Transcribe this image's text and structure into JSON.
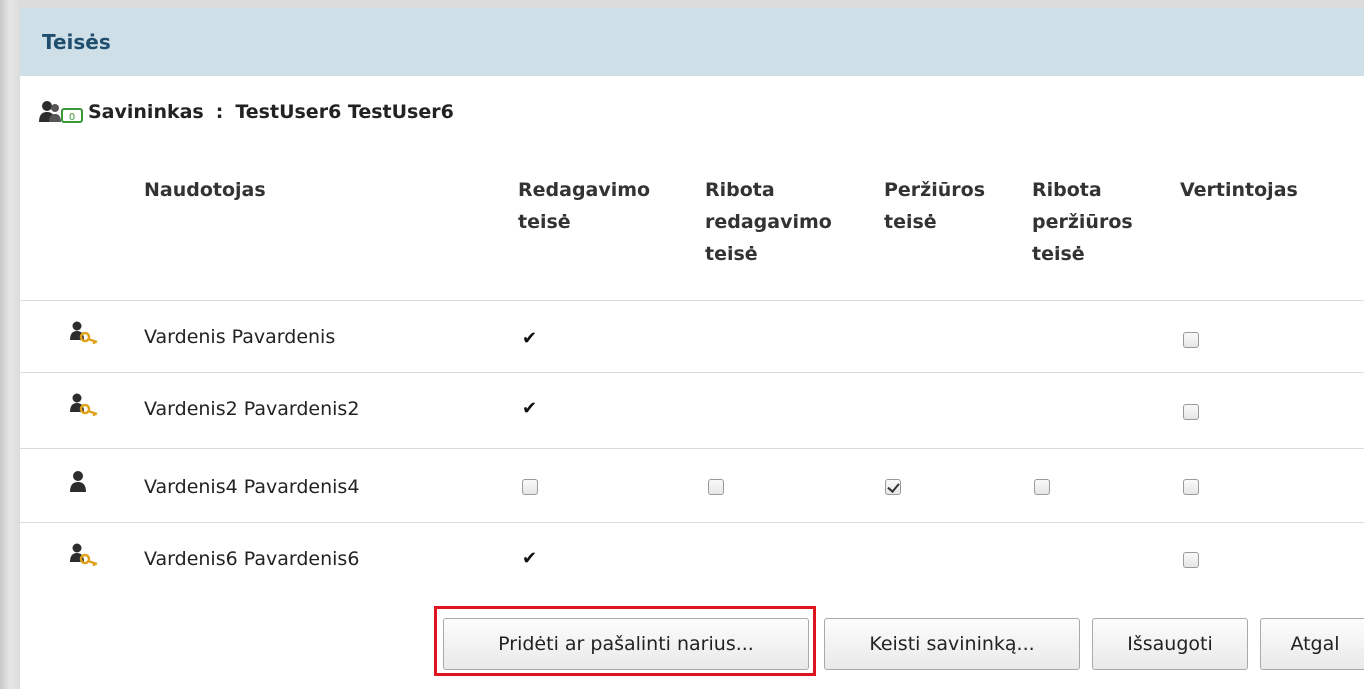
{
  "panel": {
    "title": "Teisės"
  },
  "owner": {
    "label": "Savininkas",
    "separator": ":",
    "name": "TestUser6 TestUser6",
    "icon": "owner-badge-icon"
  },
  "columns": {
    "user": "Naudotojas",
    "edit": "Redagavimo\nteisė",
    "limited_edit": "Ribota\nredagavimo\nteisė",
    "view": "Peržiūros\nteisė",
    "limited_view": "Ribota\nperžiūros\nteisė",
    "reviewer": "Vertintojas"
  },
  "rows": [
    {
      "name": "Vardenis Pavardenis",
      "icon": "user-key-icon",
      "edit": "✔",
      "reviewer_checked": false
    },
    {
      "name": "Vardenis2 Pavardenis2",
      "icon": "user-key-icon",
      "edit": "✔",
      "reviewer_checked": false
    },
    {
      "name": "Vardenis4 Pavardenis4",
      "icon": "user-icon",
      "edit_checked": false,
      "limited_edit_checked": false,
      "view_checked": true,
      "limited_view_checked": false,
      "reviewer_checked": false
    },
    {
      "name": "Vardenis6 Pavardenis6",
      "icon": "user-key-icon",
      "edit": "✔",
      "reviewer_checked": false
    }
  ],
  "buttons": {
    "add_remove": "Pridėti ar pašalinti narius...",
    "change_owner": "Keisti savininką...",
    "save": "Išsaugoti",
    "back": "Atgal"
  },
  "colors": {
    "header_bg": "#cfdfe8",
    "title": "#1f4e6e",
    "highlight": "#e0141e",
    "key": "#e0a21c"
  }
}
